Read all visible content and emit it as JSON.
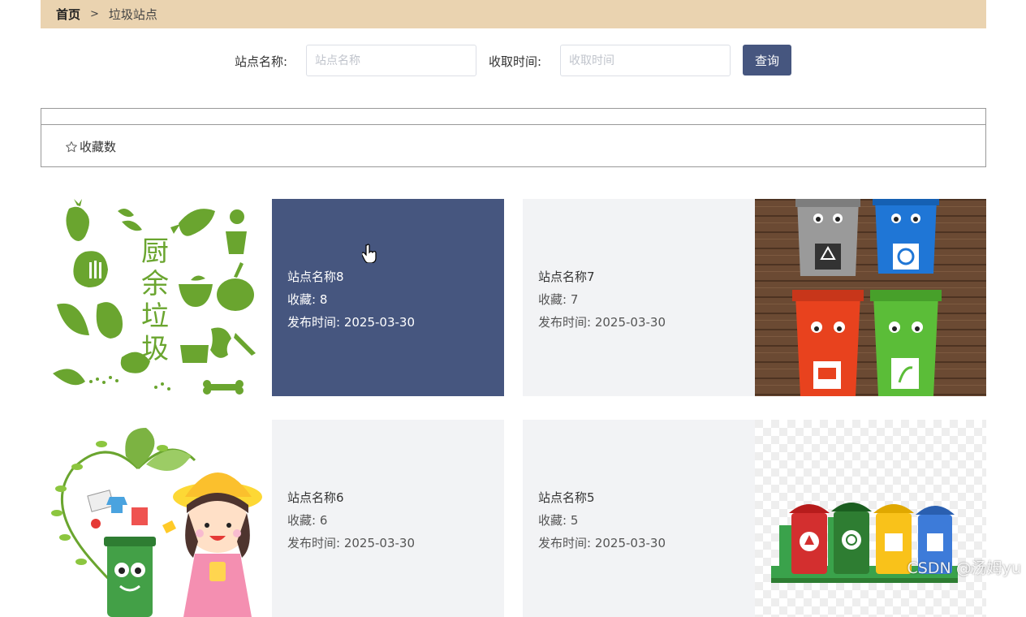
{
  "breadcrumb": {
    "home": "首页",
    "separator": ">",
    "current": "垃圾站点"
  },
  "search": {
    "name_label": "站点名称:",
    "name_placeholder": "站点名称",
    "name_value": "",
    "time_label": "收取时间:",
    "time_placeholder": "收取时间",
    "time_value": "",
    "query_label": "查询"
  },
  "sort": {
    "favorites_label": "收藏数"
  },
  "cards": [
    {
      "name": "站点名称8",
      "favorites": "收藏:  8",
      "publish": "发布时间:  2025-03-30",
      "image": "kitchen-waste-illustration"
    },
    {
      "name": "站点名称7",
      "favorites": "收藏:  7",
      "publish": "发布时间:  2025-03-30",
      "image": "smiling-trash-bins-photo"
    },
    {
      "name": "站点名称6",
      "favorites": "收藏:  6",
      "publish": "发布时间:  2025-03-30",
      "image": "girl-recycling-illustration"
    },
    {
      "name": "站点名称5",
      "favorites": "收藏:  5",
      "publish": "发布时间:  2025-03-30",
      "image": "colored-bins-illustration"
    }
  ],
  "watermark": "CSDN @汤姆yu",
  "colors": {
    "breadcrumb_bg": "#ead3b0",
    "accent": "#46567f",
    "info_bg": "#f2f3f5",
    "green": "#6aa52f"
  }
}
